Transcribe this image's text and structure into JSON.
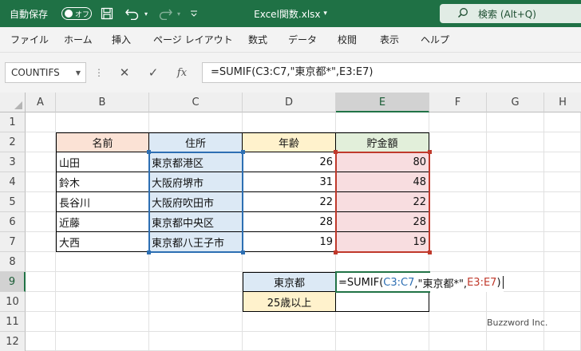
{
  "titlebar": {
    "autosave_label": "自動保存",
    "autosave_state": "オフ",
    "filename": "Excel関数.xlsx",
    "filename_caret": "▾",
    "search_placeholder": "検索 (Alt+Q)",
    "bg_color": "#1f7145",
    "icons": [
      "save-icon",
      "undo-icon",
      "redo-icon",
      "quick-access-more-icon",
      "search-icon"
    ]
  },
  "ribbon": {
    "tabs": [
      "ファイル",
      "ホーム",
      "挿入",
      "ページ レイアウト",
      "数式",
      "データ",
      "校閲",
      "表示",
      "ヘルプ"
    ]
  },
  "formula_bar": {
    "name_box": "COUNTIFS",
    "cancel_symbol": "✕",
    "enter_symbol": "✓",
    "fx_symbol": "fx",
    "formula": "=SUMIF(C3:C7,\"東京都*\",E3:E7)"
  },
  "grid": {
    "columns": [
      "A",
      "B",
      "C",
      "D",
      "E",
      "F",
      "G",
      "H"
    ],
    "rows": [
      "1",
      "2",
      "3",
      "4",
      "5",
      "6",
      "7",
      "8",
      "9",
      "10",
      "11",
      "12"
    ],
    "selected_column": "E",
    "selected_row": "9",
    "header_row": [
      "名前",
      "住所",
      "年齢",
      "貯金額"
    ],
    "header_colors": [
      "#fbe2d5",
      "#dce9f5",
      "#fff2cc",
      "#e2efda"
    ],
    "data_rows": [
      {
        "name": "山田",
        "address": "東京都港区",
        "age": "26",
        "savings": "80"
      },
      {
        "name": "鈴木",
        "address": "大阪府堺市",
        "age": "31",
        "savings": "48"
      },
      {
        "name": "長谷川",
        "address": "大阪府吹田市",
        "age": "22",
        "savings": "22"
      },
      {
        "name": "近藤",
        "address": "東京都中央区",
        "age": "28",
        "savings": "28"
      },
      {
        "name": "大西",
        "address": "東京都八王子市",
        "age": "19",
        "savings": "19"
      }
    ],
    "criteria": [
      {
        "label": "東京都",
        "color": "#dce9f5"
      },
      {
        "label": "25歳以上",
        "color": "#fff2cc"
      }
    ],
    "editing": {
      "prefix": "=SUMIF(",
      "range1": "C3:C7",
      "middle": ",\"東京都*\",",
      "range2": "E3:E7",
      "suffix": ")"
    },
    "range_colors": {
      "range1": "#2d6fb3",
      "range2": "#c0392b",
      "selection": "#217346"
    }
  },
  "watermark": "Buzzword Inc."
}
